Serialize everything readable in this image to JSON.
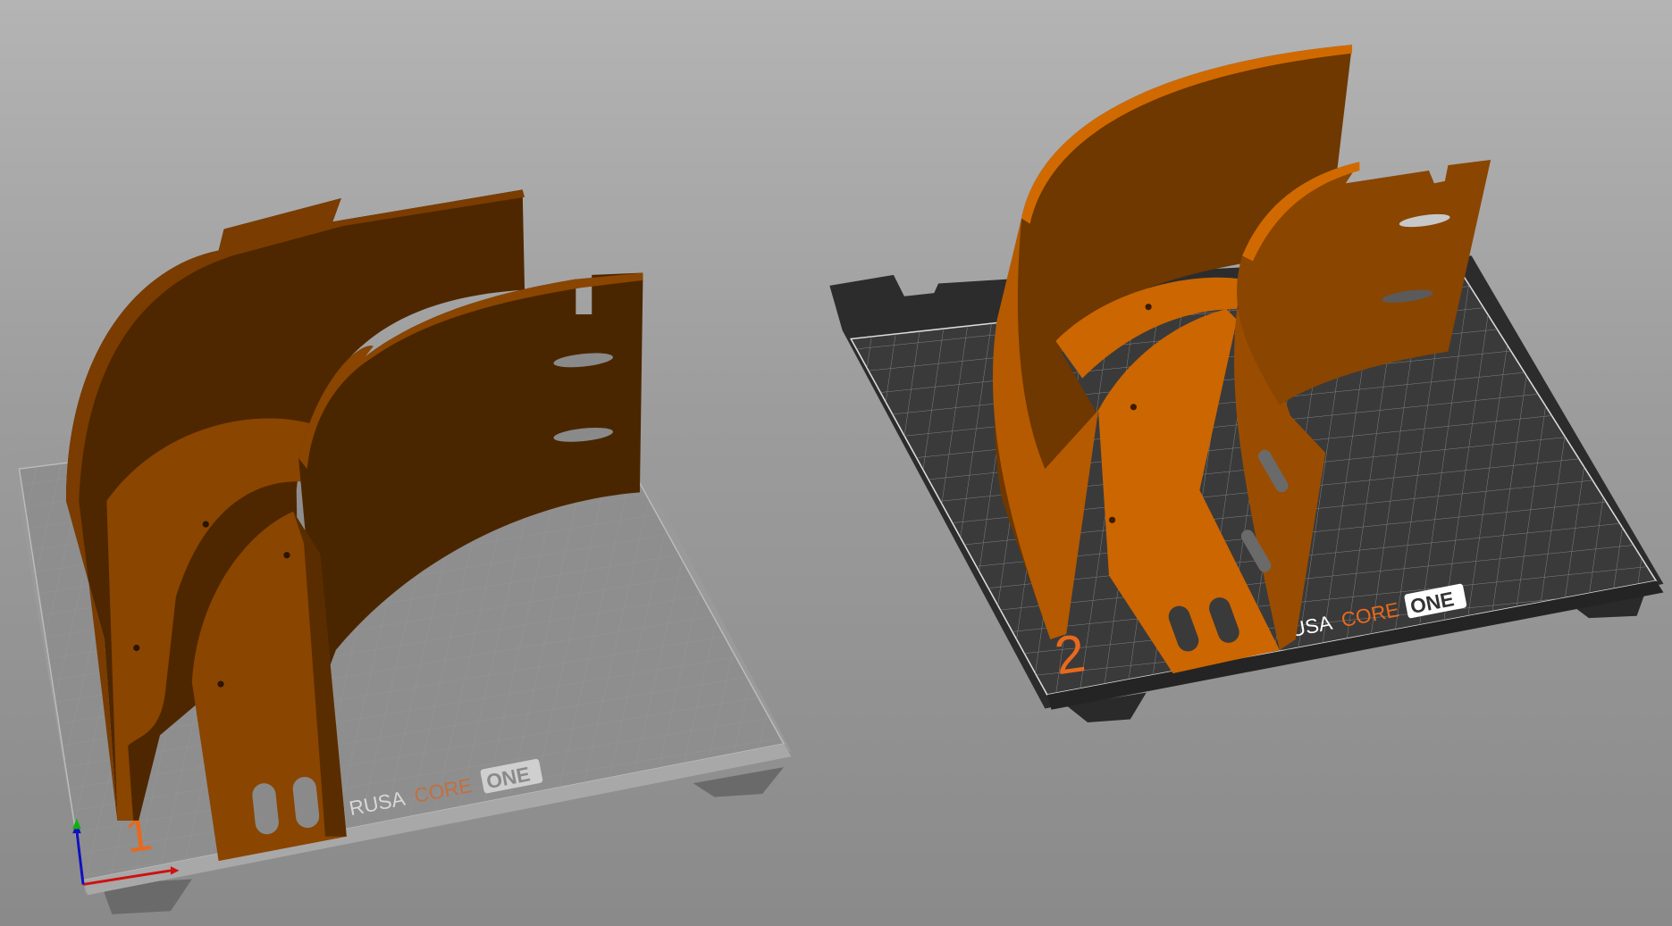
{
  "viewport": {
    "beds": [
      {
        "number": "1",
        "active": false,
        "logo": {
          "brand": "RUSA",
          "core": "CORE",
          "one": "ONE"
        },
        "sheet_color": "#8c8c8c"
      },
      {
        "number": "2",
        "active": true,
        "logo": {
          "brand": "RUSA",
          "core": "CORE",
          "one": "ONE"
        },
        "sheet_color": "#383838"
      }
    ],
    "colors": {
      "part_light": "#cc6600",
      "part_mid": "#8a4500",
      "part_dark": "#4a2600",
      "logo_accent": "#e8691c",
      "axis_x": "#d01010",
      "axis_y": "#10b010",
      "axis_z": "#1010c0"
    }
  }
}
